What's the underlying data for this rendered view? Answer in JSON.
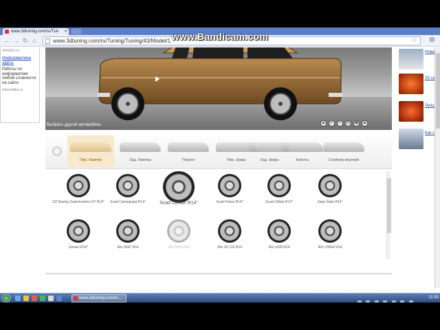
{
  "watermark": "www.Bandicam.com",
  "browser": {
    "tab_title": "www.3dtuning.com/ru/Tun",
    "url": "www.3dtuning.com/ru/Tuning/Tuning/43/Model/1"
  },
  "left_sidebar": {
    "counter": "4000001 m",
    "link": "Информатика здесь",
    "text": "Работы по информатике любой сложности на сайте",
    "small": "informatika.ru"
  },
  "stage": {
    "choose_car": "Выбрать другой автомобиль",
    "controls": [
      "▲",
      "◐",
      "◐",
      "◎",
      "◉",
      "▲"
    ]
  },
  "parts": [
    {
      "label": "Пер. бампер",
      "active": true
    },
    {
      "label": "Зад. бампер",
      "active": false
    },
    {
      "label": "Пороги",
      "active": false
    },
    {
      "label": "Пер. фары",
      "active": false
    },
    {
      "label": "Зад. фары",
      "active": false
    },
    {
      "label": "Капоты",
      "active": false
    },
    {
      "label": "Спойлер верхний",
      "active": false
    }
  ],
  "wheels": [
    {
      "label": "OZ Racing Superturismo GT R14\""
    },
    {
      "label": "Scad Саппоріура R14\""
    },
    {
      "label": "Scad Castor R14\""
    },
    {
      "label": "Scad Febos R14\""
    },
    {
      "label": "Scad Odinia R14\""
    },
    {
      "label": "Zepp Sarts R14\""
    },
    {
      "label": "Zeraex R14\""
    },
    {
      "label": "40о 5047 R14"
    },
    {
      "label": "40о 5019 R14"
    },
    {
      "label": "40о 3D 119 R14"
    },
    {
      "label": "40о х028 R14"
    },
    {
      "label": "40о V3064 R14"
    }
  ],
  "right_sidebar": [
    {
      "text": "Нова"
    },
    {
      "text": "25 са"
    },
    {
      "text": "Лучш"
    },
    {
      "text": "Как с"
    }
  ],
  "taskbar": {
    "task_title": "www.3dtuning.com/ru...",
    "clock": "11:55"
  }
}
